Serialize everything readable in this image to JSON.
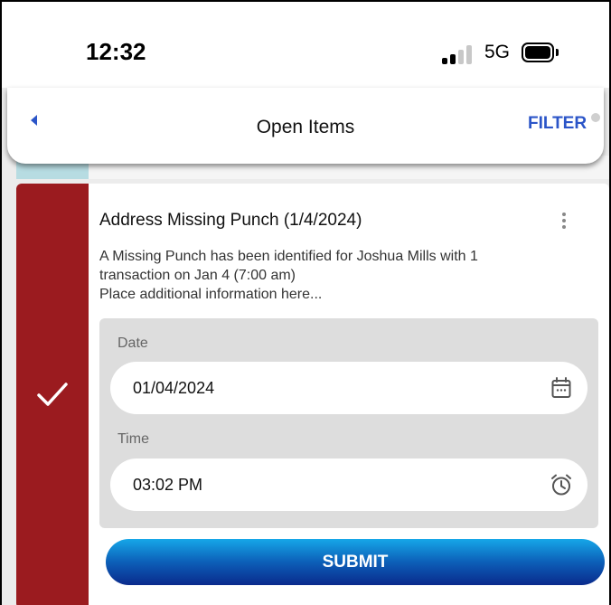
{
  "status_bar": {
    "time": "12:32",
    "network": "5G",
    "signal_bars": 2,
    "signal_bars_total": 4,
    "battery_level": 1.0
  },
  "header": {
    "back_icon": "chevron-left-icon",
    "title": "Open Items",
    "filter_label": "FILTER",
    "accent_color": "#2b55c8"
  },
  "card": {
    "status_color": "#9b1b1f",
    "status_icon": "check-icon",
    "title": "Address Missing Punch (1/4/2024)",
    "menu_icon": "kebab-menu-icon",
    "description_lines": [
      "A Missing Punch has been identified for Joshua Mills with 1",
      "transaction on Jan 4 (7:00 am)",
      "Place additional information here..."
    ],
    "date": {
      "label": "Date",
      "value": "01/04/2024",
      "icon": "calendar-icon"
    },
    "time": {
      "label": "Time",
      "value": "03:02 PM",
      "icon": "alarm-clock-icon"
    },
    "submit_label": "SUBMIT"
  }
}
